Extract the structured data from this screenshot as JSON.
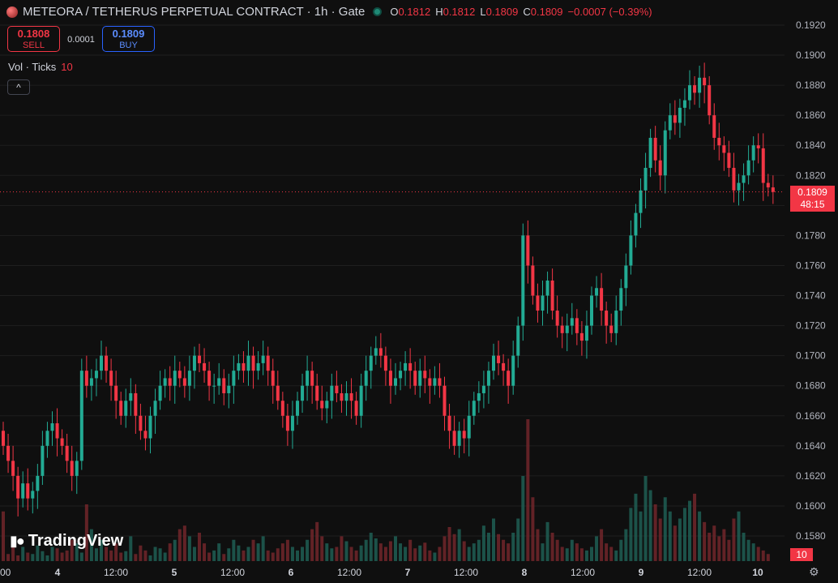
{
  "header": {
    "title": "METEORA / TETHERUS PERPETUAL CONTRACT · 1h · Gate",
    "ohlc": [
      {
        "k": "O",
        "v": "0.1812"
      },
      {
        "k": "H",
        "v": "0.1812"
      },
      {
        "k": "L",
        "v": "0.1809"
      },
      {
        "k": "C",
        "v": "0.1809"
      },
      {
        "k": "",
        "v": "−0.0007 (−0.39%)"
      }
    ]
  },
  "trade": {
    "sell_price": "0.1808",
    "sell_label": "SELL",
    "spread": "0.0001",
    "buy_price": "0.1809",
    "buy_label": "BUY"
  },
  "volume": {
    "label": "Vol · Ticks",
    "value": "10"
  },
  "collapse_icon": "chevron-up-icon",
  "brand": {
    "logo_text": "TradingView"
  },
  "last_price": {
    "price": "0.1809",
    "countdown": "48:15",
    "volume": "10"
  },
  "settings_icon": "gear-icon",
  "colors": {
    "up": "#22ab94",
    "down": "#f23645",
    "bg": "#0f0f0f",
    "grid": "#1f1f1f",
    "text": "#d1d4dc"
  },
  "chart_data": {
    "type": "candlestick",
    "interval": "1h",
    "ylim": [
      0.157,
      0.1925
    ],
    "y_ticks": [
      "0.1920",
      "0.1900",
      "0.1880",
      "0.1860",
      "0.1840",
      "0.1820",
      "0.1800",
      "0.1780",
      "0.1760",
      "0.1740",
      "0.1720",
      "0.1700",
      "0.1680",
      "0.1660",
      "0.1640",
      "0.1620",
      "0.1600",
      "0.1580"
    ],
    "x_tick_labels": [
      "00",
      "4",
      "12:00",
      "5",
      "12:00",
      "6",
      "12:00",
      "7",
      "12:00",
      "8",
      "12:00",
      "9",
      "12:00",
      "10"
    ],
    "x_tick_bold": [
      "4",
      "5",
      "6",
      "7",
      "8",
      "9",
      "10"
    ],
    "last_price": 0.1809,
    "closes": [
      0.164,
      0.163,
      0.162,
      0.1605,
      0.1615,
      0.1605,
      0.161,
      0.162,
      0.164,
      0.165,
      0.1655,
      0.1645,
      0.164,
      0.163,
      0.162,
      0.163,
      0.169,
      0.168,
      0.1685,
      0.169,
      0.17,
      0.169,
      0.168,
      0.167,
      0.166,
      0.167,
      0.1675,
      0.166,
      0.165,
      0.1645,
      0.166,
      0.167,
      0.168,
      0.1685,
      0.168,
      0.169,
      0.1685,
      0.168,
      0.169,
      0.17,
      0.1695,
      0.169,
      0.168,
      0.168,
      0.1685,
      0.1675,
      0.168,
      0.169,
      0.1695,
      0.169,
      0.17,
      0.169,
      0.1695,
      0.17,
      0.169,
      0.168,
      0.167,
      0.166,
      0.165,
      0.166,
      0.167,
      0.168,
      0.169,
      0.168,
      0.167,
      0.1665,
      0.167,
      0.168,
      0.1675,
      0.167,
      0.1675,
      0.167,
      0.166,
      0.168,
      0.169,
      0.17,
      0.1705,
      0.17,
      0.169,
      0.168,
      0.1685,
      0.169,
      0.1695,
      0.169,
      0.168,
      0.169,
      0.1685,
      0.168,
      0.1685,
      0.168,
      0.166,
      0.165,
      0.164,
      0.165,
      0.1645,
      0.166,
      0.167,
      0.1675,
      0.168,
      0.169,
      0.17,
      0.1695,
      0.169,
      0.168,
      0.17,
      0.172,
      0.178,
      0.176,
      0.174,
      0.173,
      0.174,
      0.175,
      0.173,
      0.172,
      0.1715,
      0.172,
      0.1725,
      0.1715,
      0.171,
      0.172,
      0.174,
      0.1745,
      0.173,
      0.172,
      0.1715,
      0.173,
      0.1745,
      0.176,
      0.178,
      0.1795,
      0.181,
      0.1825,
      0.1845,
      0.183,
      0.182,
      0.185,
      0.186,
      0.1855,
      0.1865,
      0.187,
      0.188,
      0.1875,
      0.1885,
      0.188,
      0.186,
      0.1845,
      0.184,
      0.1835,
      0.1825,
      0.181,
      0.1815,
      0.182,
      0.183,
      0.184,
      0.1838,
      0.1815,
      0.1812,
      0.1809
    ],
    "volumes": [
      70,
      10,
      25,
      8,
      20,
      12,
      10,
      22,
      14,
      8,
      20,
      18,
      12,
      15,
      30,
      25,
      12,
      80,
      45,
      18,
      30,
      20,
      15,
      25,
      12,
      14,
      35,
      10,
      22,
      15,
      8,
      20,
      18,
      12,
      25,
      30,
      45,
      50,
      35,
      20,
      40,
      25,
      12,
      15,
      25,
      10,
      18,
      30,
      22,
      15,
      20,
      30,
      25,
      35,
      15,
      12,
      18,
      25,
      30,
      20,
      15,
      20,
      30,
      45,
      55,
      35,
      25,
      18,
      20,
      35,
      28,
      20,
      15,
      22,
      30,
      40,
      32,
      25,
      20,
      28,
      35,
      25,
      20,
      30,
      18,
      22,
      26,
      15,
      12,
      20,
      35,
      48,
      38,
      45,
      28,
      20,
      25,
      30,
      50,
      40,
      60,
      38,
      30,
      25,
      40,
      60,
      120,
      200,
      90,
      45,
      25,
      55,
      40,
      30,
      20,
      18,
      30,
      25,
      18,
      15,
      20,
      35,
      45,
      25,
      20,
      15,
      30,
      45,
      75,
      95,
      70,
      120,
      100,
      80,
      60,
      90,
      70,
      50,
      60,
      75,
      85,
      95,
      70,
      55,
      40,
      50,
      35,
      45,
      30,
      60,
      70,
      40,
      30,
      25,
      20,
      15,
      10
    ]
  }
}
